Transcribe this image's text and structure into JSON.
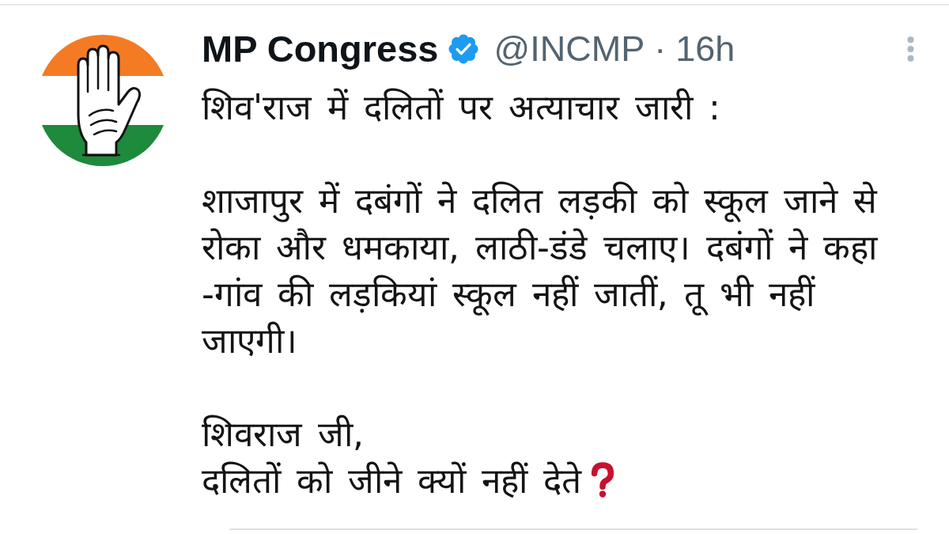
{
  "tweet": {
    "author": {
      "name": "MP Congress",
      "verified": true,
      "handle": "@INCMP"
    },
    "separator": "·",
    "time": "16h",
    "paragraphs": [
      "शिव'राज में दलितों पर अत्याचार जारी :",
      "शाजापुर में दबंगों ने दलित लड़की को स्कूल जाने से रोका और धमकाया, लाठी-डंडे चलाए। दबंगों ने कहा -गांव की लड़कियां स्कूल नहीं जातीं, तू भी नहीं जाएगी।",
      "शिवराज जी,\nदलितों को जीने क्यों नहीं देते"
    ]
  }
}
